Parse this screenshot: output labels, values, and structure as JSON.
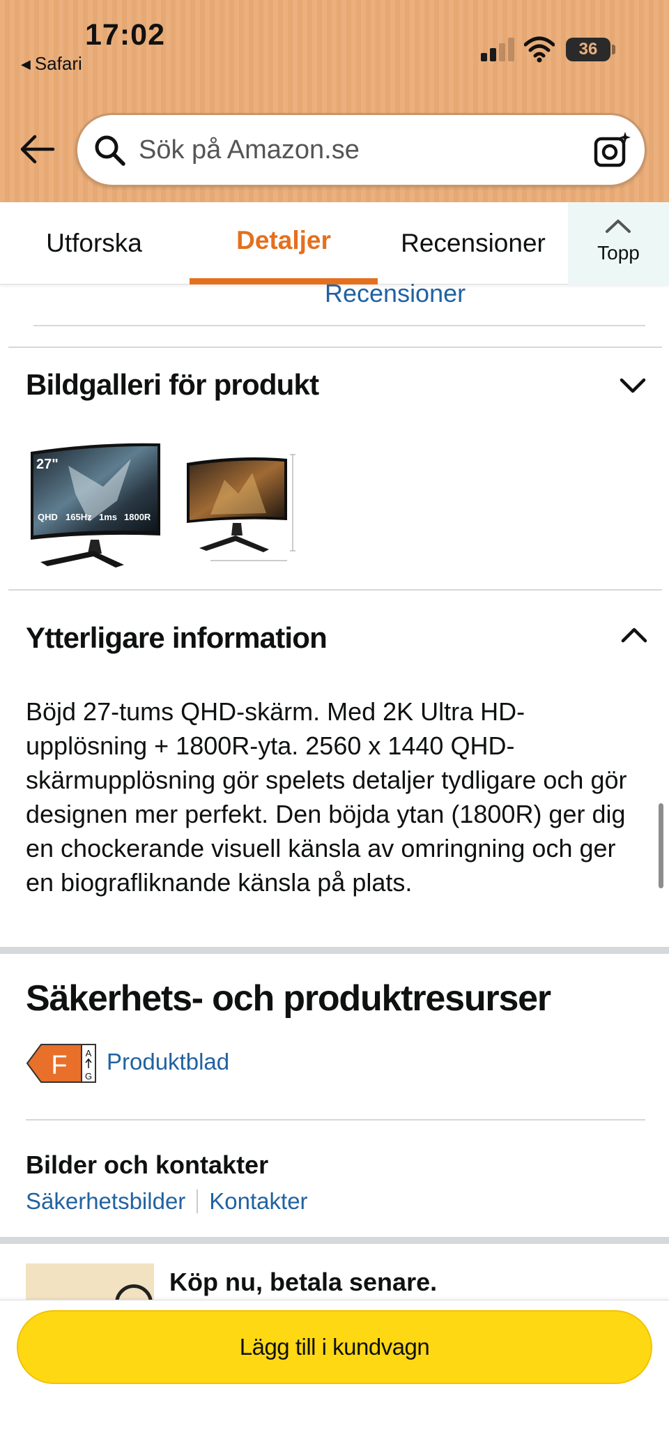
{
  "status_bar": {
    "time": "17:02",
    "back_app": "Safari",
    "battery": "36"
  },
  "search": {
    "placeholder": "Sök på Amazon.se"
  },
  "tabs": [
    {
      "label": "Utforska"
    },
    {
      "label": "Detaljer",
      "active": true
    },
    {
      "label": "Recensioner"
    },
    {
      "label": "Topp"
    }
  ],
  "content": {
    "reviews_link": "Recensioner",
    "gallery": {
      "title": "Bildgalleri för produkt",
      "expanded": false,
      "images": [
        {
          "badges": [
            "27\"",
            "QHD",
            "165Hz",
            "1ms",
            "1800R"
          ]
        },
        {
          "badges": []
        }
      ]
    },
    "additional_info": {
      "title": "Ytterligare information",
      "expanded": true,
      "text": "Böjd 27-tums QHD-skärm. Med 2K Ultra HD-upplösning + 1800R-yta. 2560 x 1440 QHD-skärmupplösning gör spelets detaljer tydligare och gör designen mer perfekt. Den böjda ytan (1800R) ger dig en chockerande visuell känsla av omringning och ger en biografliknande känsla på plats."
    },
    "safety": {
      "title": "Säkerhets- och produktresurser",
      "energy_class": "F",
      "energy_scale_top": "A",
      "energy_scale_bottom": "G",
      "datasheet_link": "Produktblad",
      "images_contacts_title": "Bilder och kontakter",
      "safety_images_link": "Säkerhetsbilder",
      "contacts_link": "Kontakter"
    },
    "promo": {
      "title": "Köp nu, betala senare."
    }
  },
  "bottom": {
    "add_to_cart": "Lägg till i kundvagn"
  },
  "colors": {
    "header_bg": "#ebb07e",
    "accent_orange": "#e4701e",
    "link_blue": "#2162a1",
    "cart_yellow": "#ffd814",
    "energy_orange": "#e8702a"
  }
}
